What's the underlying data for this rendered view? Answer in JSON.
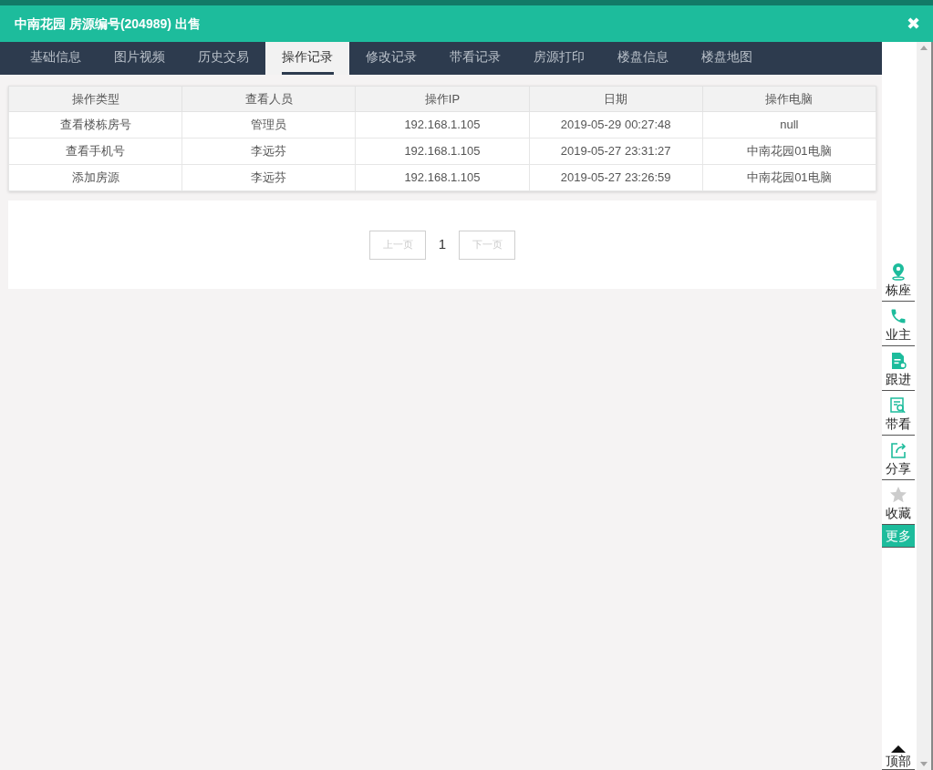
{
  "window": {
    "title": "中南花园 房源编号(204989) 出售",
    "close": "✖"
  },
  "tabs": [
    {
      "label": "基础信息",
      "selected": false
    },
    {
      "label": "图片视频",
      "selected": false
    },
    {
      "label": "历史交易",
      "selected": false
    },
    {
      "label": "操作记录",
      "selected": true
    },
    {
      "label": "修改记录",
      "selected": false
    },
    {
      "label": "带看记录",
      "selected": false
    },
    {
      "label": "房源打印",
      "selected": false
    },
    {
      "label": "楼盘信息",
      "selected": false
    },
    {
      "label": "楼盘地图",
      "selected": false
    }
  ],
  "table": {
    "columns": [
      "操作类型",
      "查看人员",
      "操作IP",
      "日期",
      "操作电脑"
    ],
    "rows": [
      [
        "查看楼栋房号",
        "管理员",
        "192.168.1.105",
        "2019-05-29 00:27:48",
        "null"
      ],
      [
        "查看手机号",
        "李远芬",
        "192.168.1.105",
        "2019-05-27 23:31:27",
        "中南花园01电脑"
      ],
      [
        "添加房源",
        "李远芬",
        "192.168.1.105",
        "2019-05-27 23:26:59",
        "中南花园01电脑"
      ]
    ]
  },
  "pagination": {
    "prev": "上一页",
    "page": "1",
    "next": "下一页"
  },
  "side_actions": [
    {
      "label": "栋座",
      "kind": "pin",
      "selected": false
    },
    {
      "label": "业主",
      "kind": "phone",
      "selected": false
    },
    {
      "label": "跟进",
      "kind": "doc",
      "selected": false
    },
    {
      "label": "带看",
      "kind": "search",
      "selected": false
    },
    {
      "label": "分享",
      "kind": "share",
      "selected": false
    },
    {
      "label": "收藏",
      "kind": "star",
      "selected": false
    },
    {
      "label": "更多",
      "kind": "text",
      "selected": true
    }
  ],
  "top_button": {
    "label": "顶部"
  }
}
